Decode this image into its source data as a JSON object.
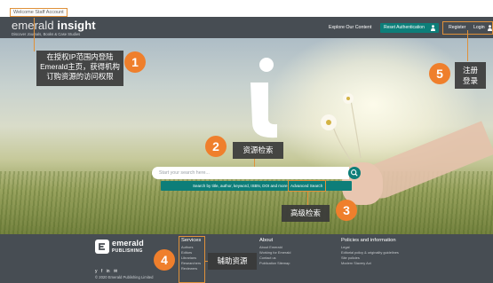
{
  "staff_bar": {
    "label": "Welcome Staff Account"
  },
  "header": {
    "logo_light": "emerald",
    "logo_bold": "insight",
    "tagline": "Discover Journals, Books & Case Studies",
    "explore": "Explore Our Content",
    "reset_auth": "Reset Authentication",
    "register": "Register",
    "login": "Login"
  },
  "search": {
    "placeholder": "Start your search here...",
    "hint": "Search by title, author, keyword, ISBN, DOI and more",
    "advanced": "Advanced Search"
  },
  "annotations": [
    {
      "number": "1",
      "text_line1": "在授权IP范围内登陆",
      "text_line2": "Emerald主页，获得机构",
      "text_line3": "订购资源的访问权限"
    },
    {
      "number": "2",
      "text": "资源检索"
    },
    {
      "number": "3",
      "text": "高级检索"
    },
    {
      "number": "4",
      "text": "辅助资源"
    },
    {
      "number": "5",
      "text_line1": "注册",
      "text_line2": "登录"
    }
  ],
  "footer": {
    "logo_name": "emerald",
    "logo_pub": "PUBLISHING",
    "social": "y f in ✉",
    "copyright": "© 2020 Emerald Publishing Limited",
    "columns": [
      {
        "heading": "Services",
        "links": [
          "Authors",
          "Editors",
          "Librarians",
          "Researchers",
          "Reviewers"
        ]
      },
      {
        "heading": "About",
        "links": [
          "About Emerald",
          "Working for Emerald",
          "Contact us",
          "Publication Sitemap"
        ]
      },
      {
        "heading": "Policies and information",
        "links": [
          "Legal",
          "Editorial policy & originality guidelines",
          "Site policies",
          "Modern Slavery Act"
        ]
      }
    ]
  },
  "colors": {
    "header_bg": "#474d53",
    "teal": "#0d7e79",
    "accent_orange": "#ef7f2c",
    "note_bg": "#3a3a3a"
  }
}
